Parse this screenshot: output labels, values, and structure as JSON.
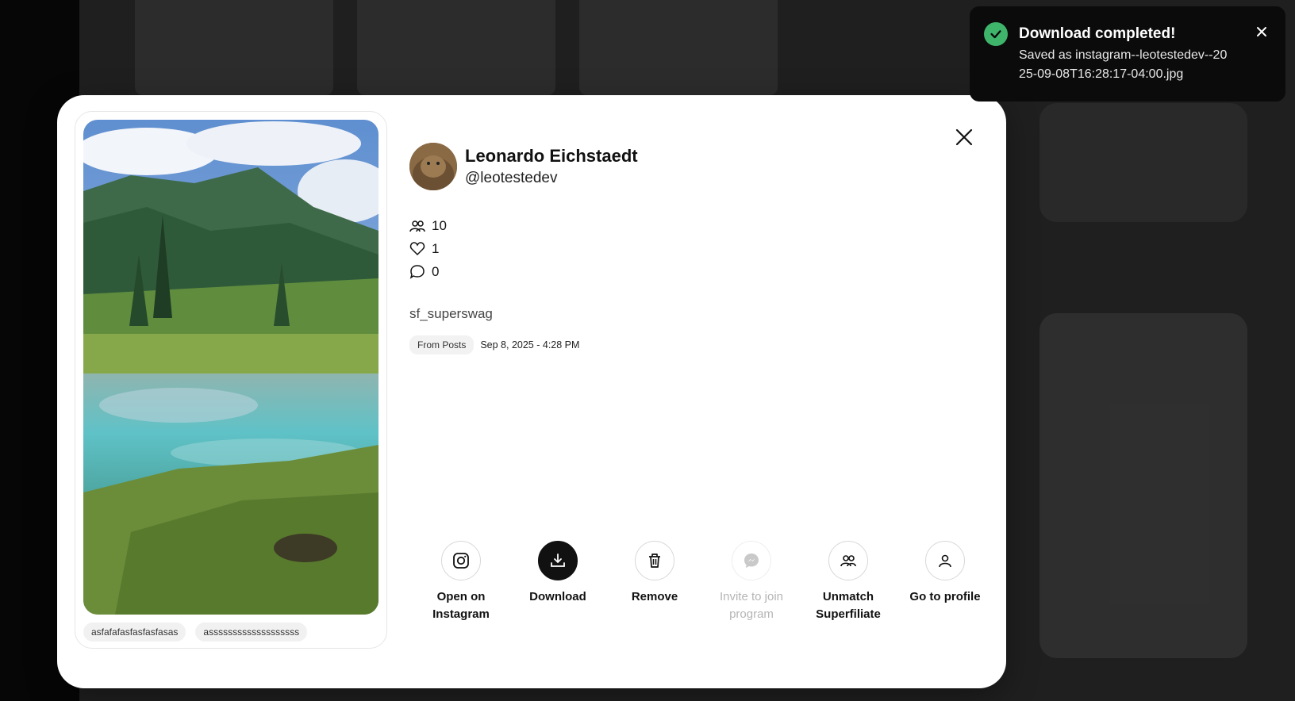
{
  "modal": {
    "profile": {
      "name": "Leonardo Eichstaedt",
      "handle": "@leotestedev"
    },
    "stats": [
      {
        "icon": "users-icon",
        "value": "10"
      },
      {
        "icon": "heart-icon",
        "value": "1"
      },
      {
        "icon": "comment-icon",
        "value": "0"
      }
    ],
    "caption": "sf_superswag",
    "source_badge": "From Posts",
    "date": "Sep 8, 2025 - 4:28 PM",
    "tags": [
      "asfafafasfasfasfasas",
      "asssssssssssssssssss"
    ],
    "actions": [
      {
        "label": "Open on Instagram",
        "icon": "instagram-icon"
      },
      {
        "label": "Download",
        "icon": "download-icon"
      },
      {
        "label": "Remove",
        "icon": "trash-icon"
      },
      {
        "label": "Invite to join program",
        "icon": "messenger-icon"
      },
      {
        "label": "Unmatch Superfiliate",
        "icon": "users-icon"
      },
      {
        "label": "Go to profile",
        "icon": "user-icon"
      }
    ]
  },
  "toast": {
    "title": "Download completed!",
    "message": "Saved as instagram--leotestedev--2025-09-08T16:28:17-04:00.jpg"
  },
  "colors": {
    "success": "#3fb56b",
    "toast_bg": "#0b0b0b",
    "primary": "#111111"
  }
}
